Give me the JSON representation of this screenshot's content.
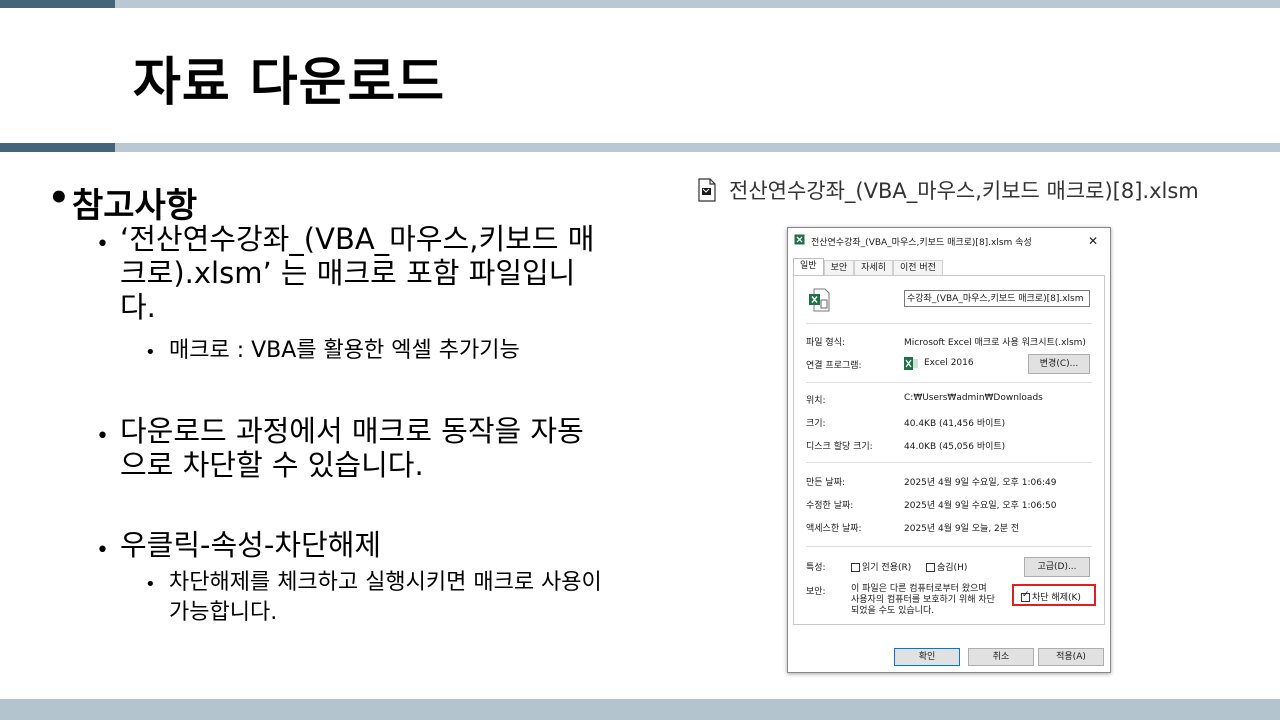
{
  "slide": {
    "title": "자료 다운로드",
    "bullets": {
      "main": "참고사항",
      "sub1": "‘전산연수강좌_(VBA_마우스,키보드 매크로).xlsm’ 는 매크로 포함 파일입니다.",
      "sub1_child": "매크로 : VBA를 활용한 엑셀 추가기능",
      "sub2": "다운로드 과정에서 매크로 동작을 자동으로 차단할 수 있습니다.",
      "sub3": "우클릭-속성-차단해제",
      "sub3_child": "차단해제를 체크하고 실행시키면 매크로 사용이 가능합니다."
    },
    "file_label": "전산연수강좌_(VBA_마우스,키보드 매크로)[8].xlsm"
  },
  "dialog": {
    "title": "전산연수강좌_(VBA_마우스,키보드 매크로)[8].xlsm 속성",
    "close": "✕",
    "tabs": [
      "일반",
      "보안",
      "자세히",
      "이전 버전"
    ],
    "filename_value": "수강좌_(VBA_마우스,키보드 매크로)[8].xlsm",
    "type_label": "파일 형식:",
    "type_value": "Microsoft Excel 매크로 사용 워크시트(.xlsm)",
    "opens_label": "연결 프로그램:",
    "opens_value": "Excel 2016",
    "change_btn": "변경(C)...",
    "location_label": "위치:",
    "location_value": "C:₩Users₩admin₩Downloads",
    "size_label": "크기:",
    "size_value": "40.4KB (41,456 바이트)",
    "disk_label": "디스크 할당 크기:",
    "disk_value": "44.0KB (45,056 바이트)",
    "created_label": "만든 날짜:",
    "created_value": "2025년 4월 9일 수요일, 오후 1:06:49",
    "modified_label": "수정한 날짜:",
    "modified_value": "2025년 4월 9일 수요일, 오후 1:06:50",
    "accessed_label": "액세스한 날짜:",
    "accessed_value": "2025년 4월 9일 오늘, 2분 전",
    "attr_label": "특성:",
    "readonly_label": "읽기 전용(R)",
    "hidden_label": "숨김(H)",
    "advanced_btn": "고급(D)...",
    "security_label": "보안:",
    "security_text_1": "이 파일은 다른 컴퓨터로부터 왔으며",
    "security_text_2": "사용자의 컴퓨터를 보호하기 위해 차단",
    "security_text_3": "되었을 수도 있습니다.",
    "unblock_label": "차단 해제(K)",
    "unblock_checked": true,
    "ok_btn": "확인",
    "cancel_btn": "취소",
    "apply_btn": "적용(A)",
    "colors": {
      "highlight": "#e02020",
      "excel_green": "#1e7145"
    }
  }
}
